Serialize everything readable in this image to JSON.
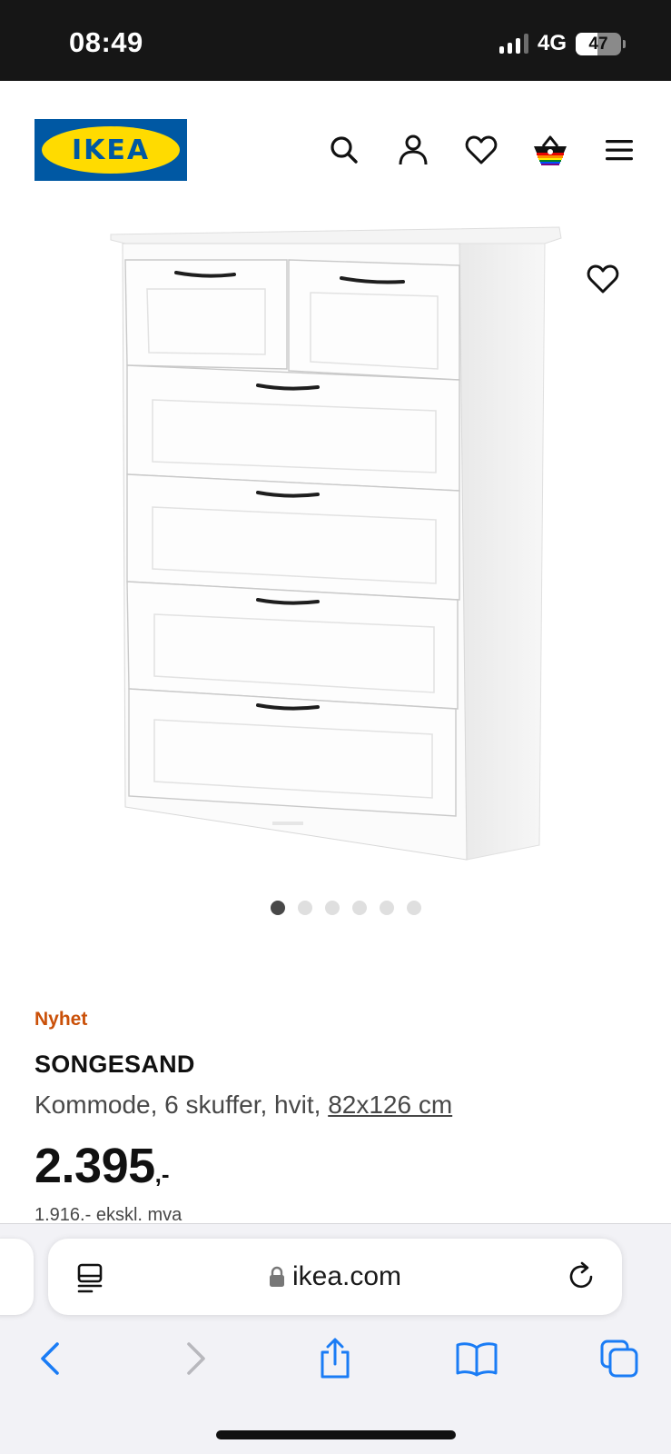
{
  "status_bar": {
    "time": "08:49",
    "network": "4G",
    "battery": "47",
    "battery_level": 0.47
  },
  "header": {
    "logo_text": "IKEA",
    "brand_colors": {
      "blue": "#0058a3",
      "yellow": "#ffdb00"
    },
    "icons": [
      "search-icon",
      "account-icon",
      "wishlist-icon",
      "cart-icon",
      "menu-icon"
    ]
  },
  "gallery": {
    "image_count": 6,
    "active_index": 0
  },
  "product": {
    "badge": "Nyhet",
    "badge_color": "#ca5008",
    "name": "SONGESAND",
    "description": "Kommode, 6 skuffer, hvit,",
    "size_link": "82x126 cm",
    "price_main": "2.395",
    "price_suffix": ",-",
    "price_ex_vat": "1.916.- ekskl. mva"
  },
  "browser": {
    "url": "ikea.com",
    "toolbar_icons": [
      "back-icon",
      "forward-icon",
      "share-icon",
      "bookmarks-icon",
      "tabs-icon"
    ]
  }
}
